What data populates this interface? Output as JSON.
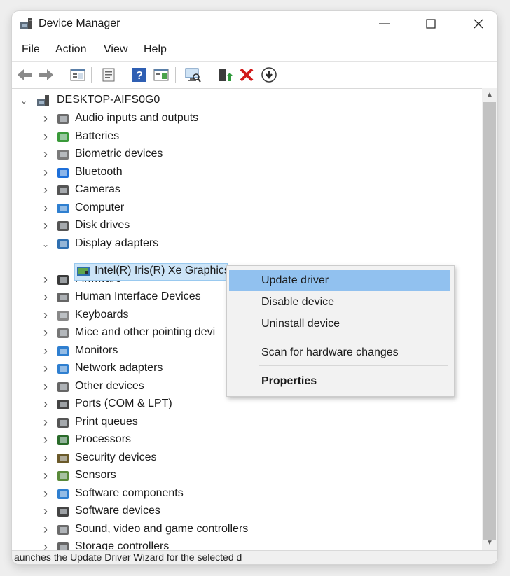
{
  "window": {
    "title": "Device Manager",
    "minimize_icon": "minimize-icon",
    "maximize_icon": "maximize-icon",
    "close_icon": "close-icon"
  },
  "menu": [
    "File",
    "Action",
    "View",
    "Help"
  ],
  "toolbar": [
    "back-arrow-icon",
    "forward-arrow-icon",
    "console-tree-icon",
    "properties-icon",
    "help-icon",
    "view-icon",
    "scan-hardware-icon",
    "update-driver-icon",
    "uninstall-icon",
    "disable-icon"
  ],
  "tree": {
    "root": "DESKTOP-AIFS0G0",
    "categories": [
      "Audio inputs and outputs",
      "Batteries",
      "Biometric devices",
      "Bluetooth",
      "Cameras",
      "Computer",
      "Disk drives",
      "Display adapters",
      "Firmware",
      "Human Interface Devices",
      "Keyboards",
      "Mice and other pointing devi",
      "Monitors",
      "Network adapters",
      "Other devices",
      "Ports (COM & LPT)",
      "Print queues",
      "Processors",
      "Security devices",
      "Sensors",
      "Software components",
      "Software devices",
      "Sound, video and game controllers",
      "Storage controllers"
    ],
    "display_child": "Intel(R) Iris(R) Xe Graphics"
  },
  "context_menu": {
    "update": "Update driver",
    "disable": "Disable device",
    "uninstall": "Uninstall device",
    "scan": "Scan for hardware changes",
    "properties": "Properties"
  },
  "status": "aunches the Update Driver Wizard for the selected d",
  "colors": {
    "selection": "#cce4f7",
    "menu_highlight": "#91c1ef",
    "accent": "#0078d7"
  }
}
